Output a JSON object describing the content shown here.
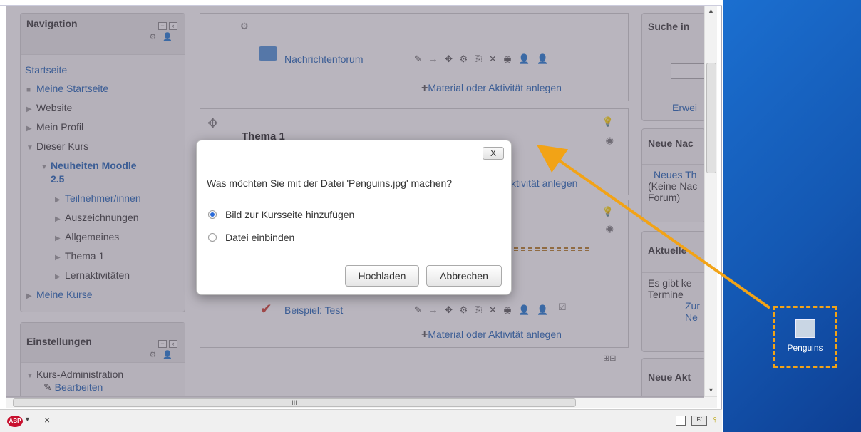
{
  "navigation": {
    "title": "Navigation",
    "home": "Startseite",
    "items": [
      {
        "label": "Meine Startseite"
      },
      {
        "label": "Website"
      },
      {
        "label": "Mein Profil"
      },
      {
        "label": "Dieser Kurs"
      },
      {
        "label": "Neuheiten Moodle"
      },
      {
        "label": "2.5"
      },
      {
        "label": "Teilnehmer/innen"
      },
      {
        "label": "Auszeichnungen"
      },
      {
        "label": "Allgemeines"
      },
      {
        "label": "Thema 1"
      },
      {
        "label": "Lernaktivitäten"
      },
      {
        "label": "Meine Kurse"
      }
    ]
  },
  "settings": {
    "title": "Einstellungen",
    "admin": "Kurs-Administration",
    "edit": "Bearbeiten"
  },
  "course": {
    "forum": "Nachrichtenforum",
    "add_activity": "Material oder Aktivität anlegen",
    "add_activity_partial": "ktivität anlegen",
    "topic1": "Thema 1",
    "test": "Beispiel: Test"
  },
  "right": {
    "search": "Suche in",
    "advanced": "Erwei",
    "news": "Neue Nac",
    "news_item": "Neues Th",
    "news_none": "(Keine Nac",
    "news_forum": "Forum)",
    "current": "Aktuelle",
    "current_text1": "Es gibt ke",
    "current_text2": "Termine",
    "current_link1": "Zur",
    "current_link2": "Ne",
    "new_acts": "Neue Akt"
  },
  "dialog": {
    "close": "X",
    "question": "Was möchten Sie mit der Datei 'Penguins.jpg' machen?",
    "option1": "Bild zur Kursseite hinzufügen",
    "option2": "Datei einbinden",
    "upload": "Hochladen",
    "cancel": "Abbrechen",
    "selected": "option1"
  },
  "desktop": {
    "icon_label": "Penguins"
  },
  "statusbar": {
    "close_x": "×",
    "abp": "ABP",
    "scroll_mark": "III"
  },
  "colors": {
    "accent_orange": "#f2a316",
    "link_blue": "#1a5fb4",
    "desktop_blue": "#1458b3"
  }
}
